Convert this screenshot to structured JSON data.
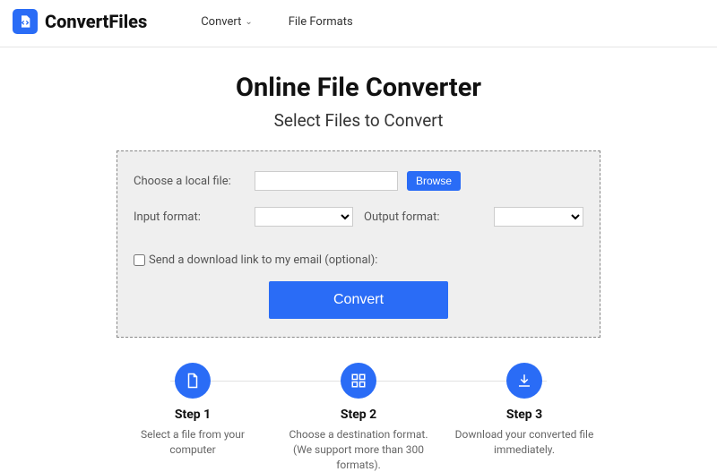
{
  "brand": "ConvertFiles",
  "nav": {
    "convert": "Convert",
    "formats": "File Formats"
  },
  "heading": "Online File Converter",
  "subheading": "Select Files to Convert",
  "panel": {
    "choose_label": "Choose a local file:",
    "browse": "Browse",
    "input_format_label": "Input format:",
    "output_format_label": "Output format:",
    "input_format_value": "",
    "output_format_value": "",
    "email_checkbox_label": "Send a download link to my email (optional):",
    "convert": "Convert"
  },
  "steps": [
    {
      "title": "Step 1",
      "desc": "Select a file from your computer"
    },
    {
      "title": "Step 2",
      "desc": "Choose a destination format. (We support more than 300 formats)."
    },
    {
      "title": "Step 3",
      "desc": "Download your converted file immediately."
    }
  ]
}
